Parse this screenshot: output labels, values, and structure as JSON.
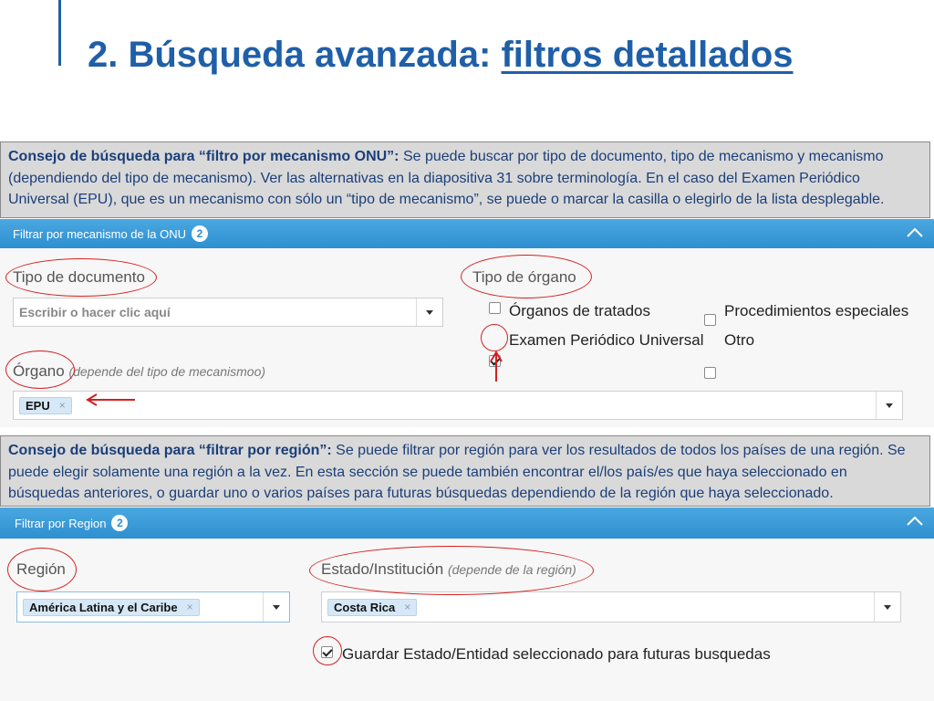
{
  "slide": {
    "title_prefix": "2. Búsqueda avanzada: ",
    "title_underlined": "filtros detallados"
  },
  "tip_mechanism": {
    "lead": "Consejo de búsqueda para “filtro por mecanismo ONU”:",
    "body": " Se puede buscar por tipo de documento, tipo de mecanismo y mecanismo (dependiendo del tipo de mecanismo). Ver las alternativas en la diapositiva 31 sobre terminología. En el caso del Examen Periódico Universal (EPU), que es un mecanismo con sólo un “tipo de mecanismo”, se puede o marcar la casilla o elegirlo de la lista desplegable."
  },
  "mechanism_panel": {
    "header": "Filtrar por mecanismo de la ONU",
    "badge": "2",
    "doc_type_label": "Tipo de documento",
    "doc_type_placeholder": "Escribir o hacer clic aquí",
    "organ_type_label": "Tipo de órgano",
    "options": [
      {
        "label": "Órganos de tratados",
        "checked": false
      },
      {
        "label": "Procedimientos especiales",
        "checked": false
      },
      {
        "label": "Examen Periódico Universal",
        "checked": true
      },
      {
        "label": "Otro",
        "checked": false
      }
    ],
    "organ_label": "Órgano",
    "organ_hint": "(depende del tipo de mecanismoo)",
    "organ_tag": "EPU"
  },
  "tip_region": {
    "lead": "Consejo de búsqueda para “filtrar por región”:",
    "body": " Se puede filtrar por región para ver los resultados de todos los países de una región. Se puede elegir solamente una región a la vez. En esta sección se puede también encontrar el/los país/es que haya seleccionado en búsquedas anteriores, o guardar uno o varios países para futuras búsquedas dependiendo de la región que haya seleccionado."
  },
  "region_panel": {
    "header": "Filtrar por Region",
    "badge": "2",
    "region_label": "Región",
    "region_tag": "América Latina y el Caribe",
    "state_label": "Estado/Institución",
    "state_hint": "(depende de la región)",
    "state_tag": "Costa Rica",
    "save_label": "Guardar Estado/Entidad seleccionado para futuras busquedas",
    "save_checked": true
  },
  "tag_remove_glyph": "×",
  "colors": {
    "title": "#1f5fa8",
    "tip_text": "#1b3f7a",
    "panel_header": "#2e8fd0",
    "annotation": "#d42020"
  }
}
